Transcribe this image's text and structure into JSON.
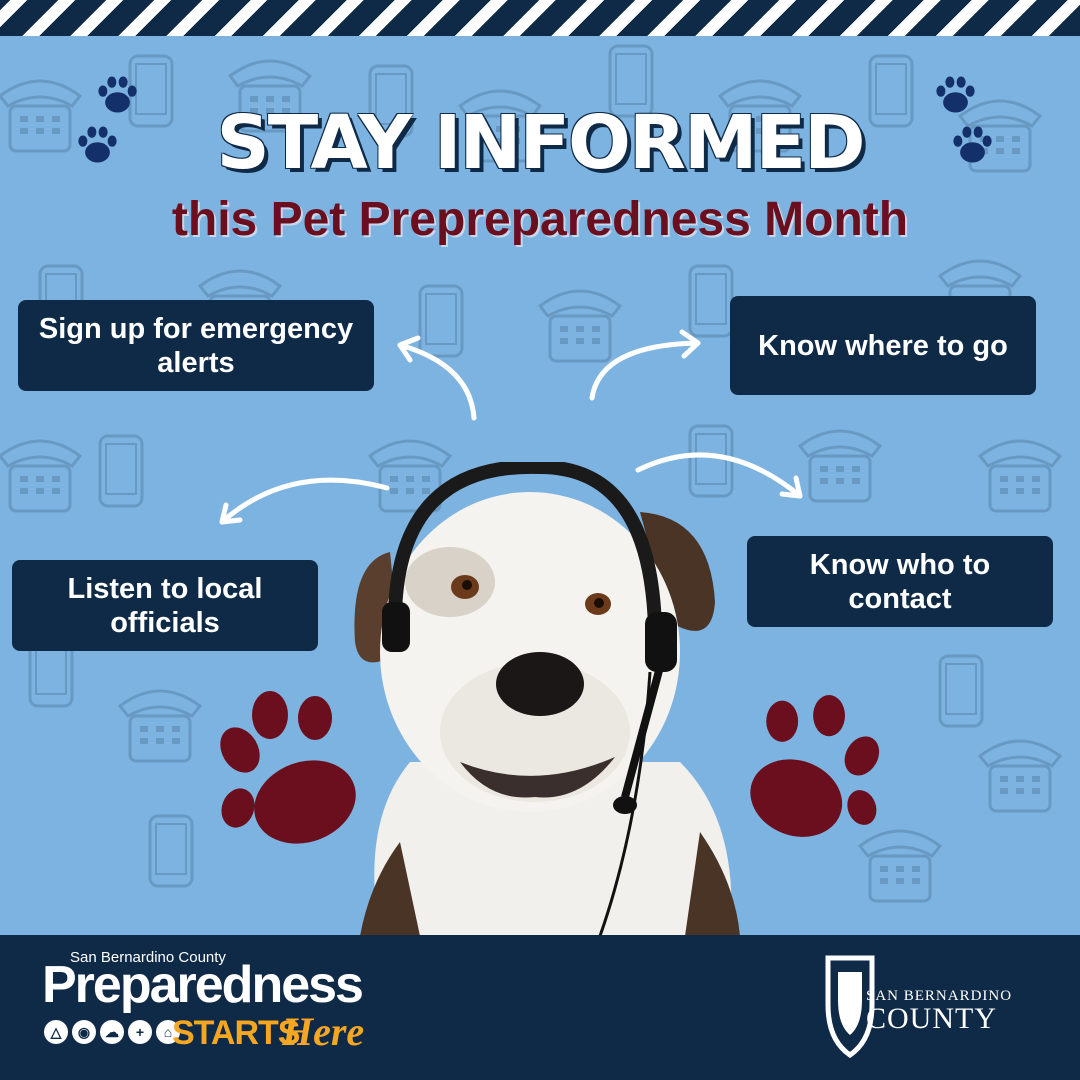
{
  "title": "STAY INFORMED",
  "subtitle": "this Pet Prepreparedness Month",
  "tips": [
    {
      "text": "Sign up for emergency alerts"
    },
    {
      "text": "Know where to go"
    },
    {
      "text": "Listen to local officials"
    },
    {
      "text": "Know who to contact"
    }
  ],
  "footer": {
    "brand_small": "San Bernardino County",
    "brand_big": "Preparedness",
    "brand_starts": "STARTS",
    "brand_here": "Here",
    "county_small": "SAN BERNARDINO",
    "county_big": "COUNTY"
  },
  "colors": {
    "background": "#7db3e0",
    "navy": "#0f2a47",
    "maroon": "#6b0f1f",
    "gold": "#f5a623"
  },
  "icons": [
    "paw-icon",
    "phone-icon",
    "arrow-icon",
    "dog-photo",
    "shield-logo-icon"
  ]
}
